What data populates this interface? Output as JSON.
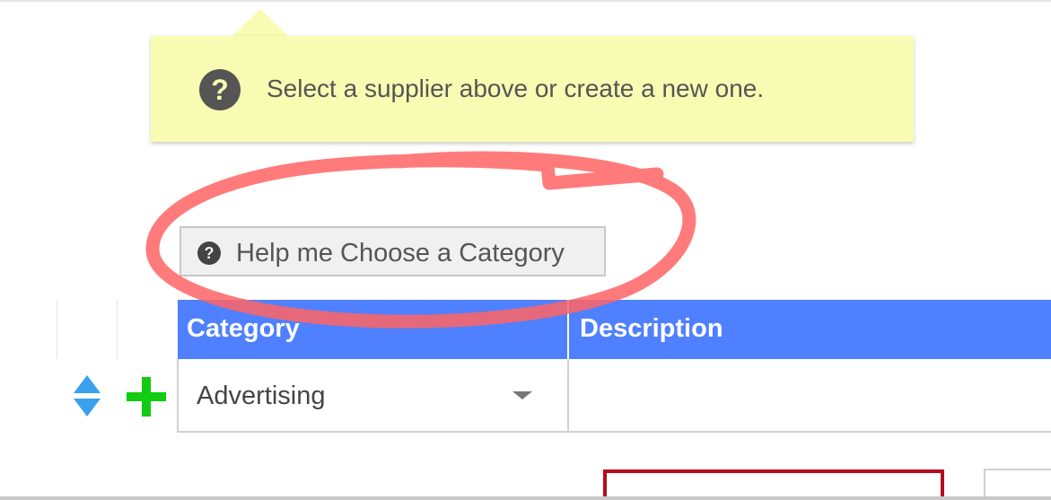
{
  "tooltip": {
    "icon": "question-circle-icon",
    "text": "Select a supplier above or create a new one."
  },
  "help_button": {
    "icon": "question-circle-icon",
    "label": "Help me Choose a Category"
  },
  "table": {
    "columns": [
      "Category",
      "Description"
    ],
    "rows": [
      {
        "category": "Advertising",
        "description": ""
      }
    ],
    "header_color": "#4f80ff"
  },
  "row_controls": {
    "sort_icon": "sort-arrows-icon",
    "add_icon": "plus-icon",
    "sort_color": "#3aa0ee",
    "add_color": "#11cc11"
  },
  "annotation": {
    "shape": "hand-drawn-circle",
    "color": "#ff6464"
  },
  "colors": {
    "tooltip_bg": "#f8fcb2",
    "field_border_error": "#b30c1e"
  }
}
